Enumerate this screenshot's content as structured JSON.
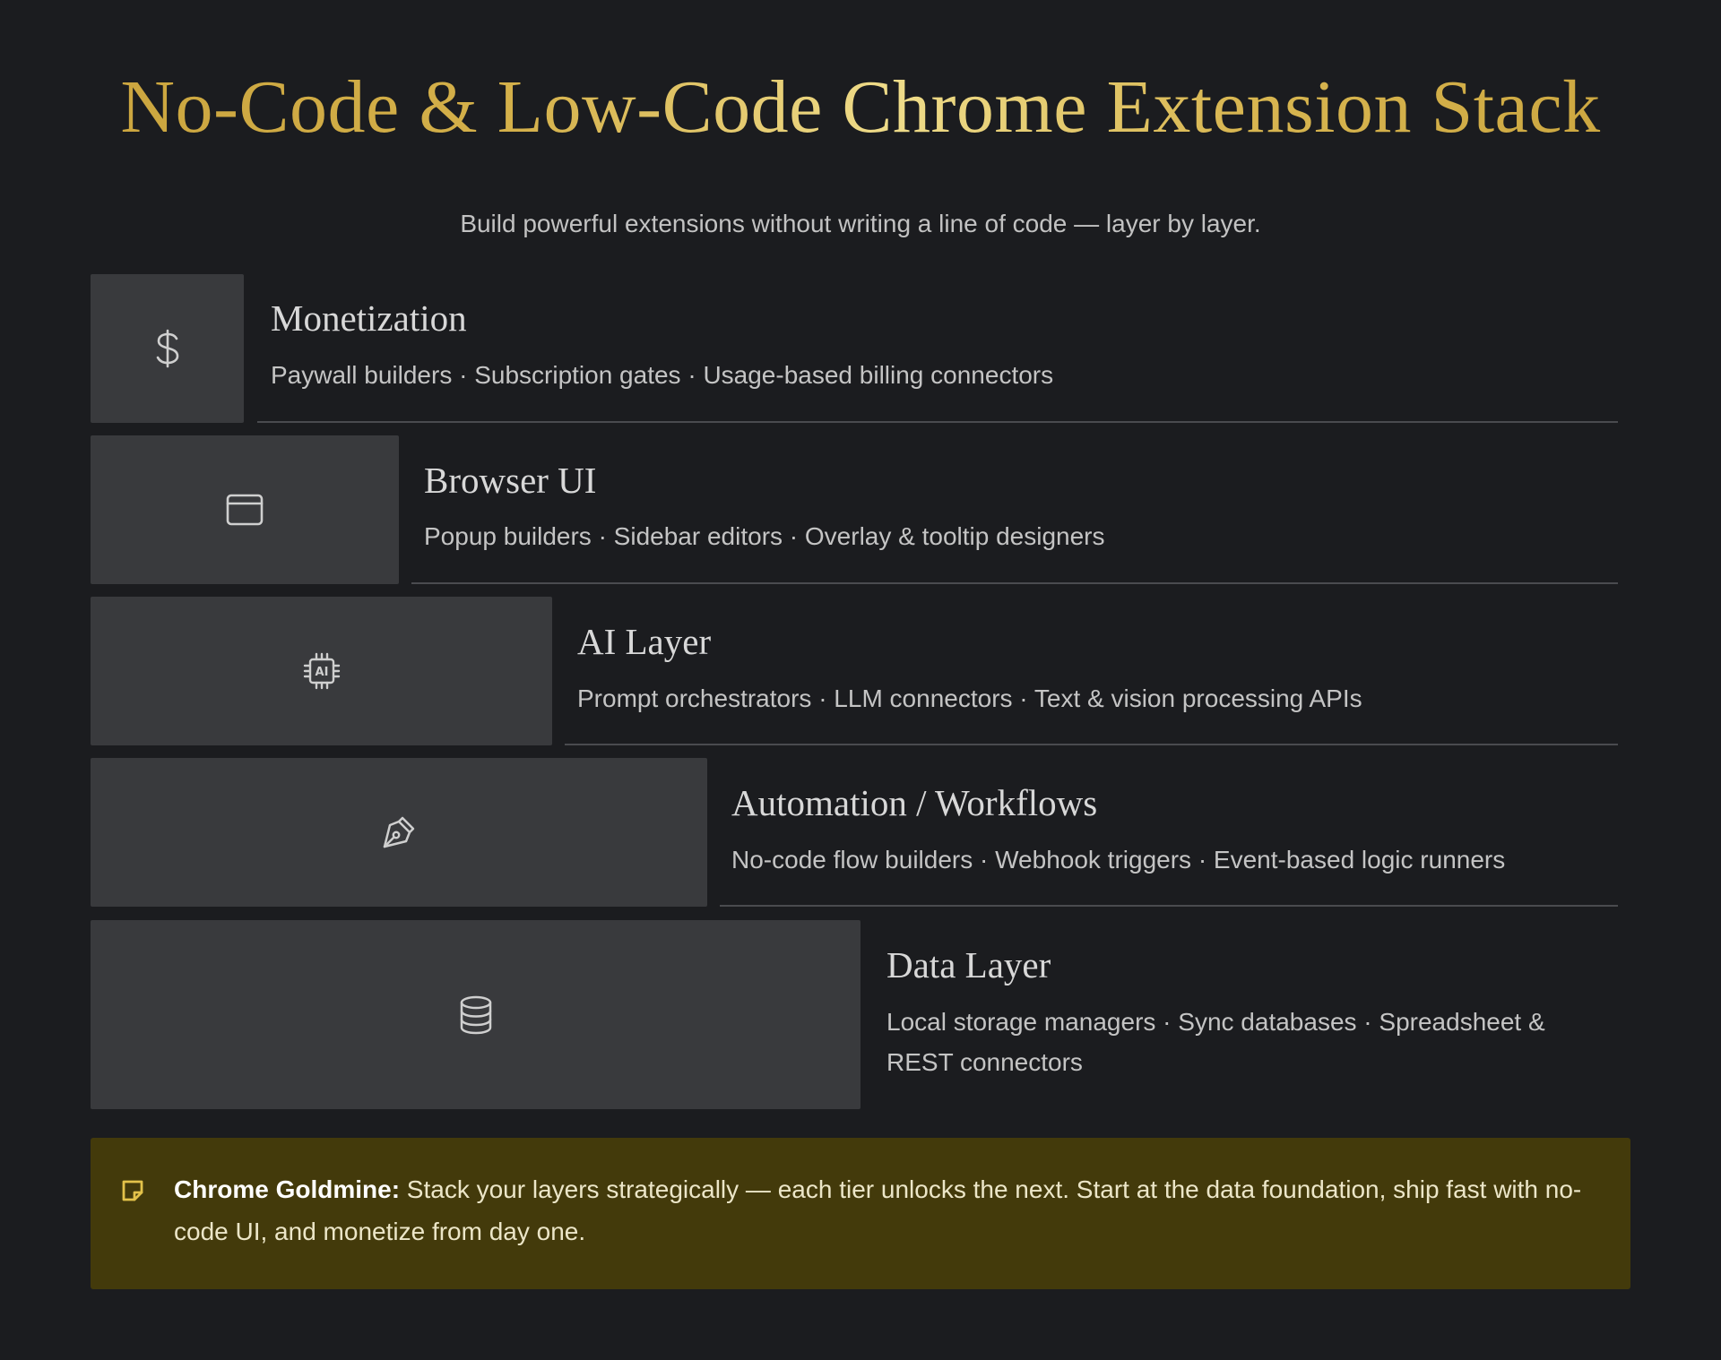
{
  "header": {
    "title": "No-Code & Low-Code Chrome Extension Stack",
    "subtitle": "Build powerful extensions without writing a line of code — layer by layer."
  },
  "layers": [
    {
      "title": "Monetization",
      "description": "Paywall builders · Subscription gates · Usage-based billing connectors",
      "icon": "dollar-icon"
    },
    {
      "title": "Browser UI",
      "description": "Popup builders · Sidebar editors · Overlay & tooltip designers",
      "icon": "browser-window-icon"
    },
    {
      "title": "AI Layer",
      "description": "Prompt orchestrators · LLM connectors · Text & vision processing APIs",
      "icon": "ai-chip-icon",
      "icon_text": "AI"
    },
    {
      "title": "Automation / Workflows",
      "description": "No-code flow builders · Webhook triggers · Event-based logic runners",
      "icon": "pen-nib-icon"
    },
    {
      "title": "Data Layer",
      "description": "Local storage managers · Sync databases · Spreadsheet & REST connectors",
      "icon": "database-icon"
    }
  ],
  "callout": {
    "label": "Chrome Goldmine:",
    "text": " Stack your layers strategically — each tier unlocks the next. Start at the data foundation, ship fast with no-code UI, and monetize from day one.",
    "icon": "note-icon"
  },
  "colors": {
    "background": "#1b1c1f",
    "block": "#393a3d",
    "title_gold": "#d4b04a",
    "callout_background": "#433a0b",
    "callout_icon": "#e3c24a"
  }
}
